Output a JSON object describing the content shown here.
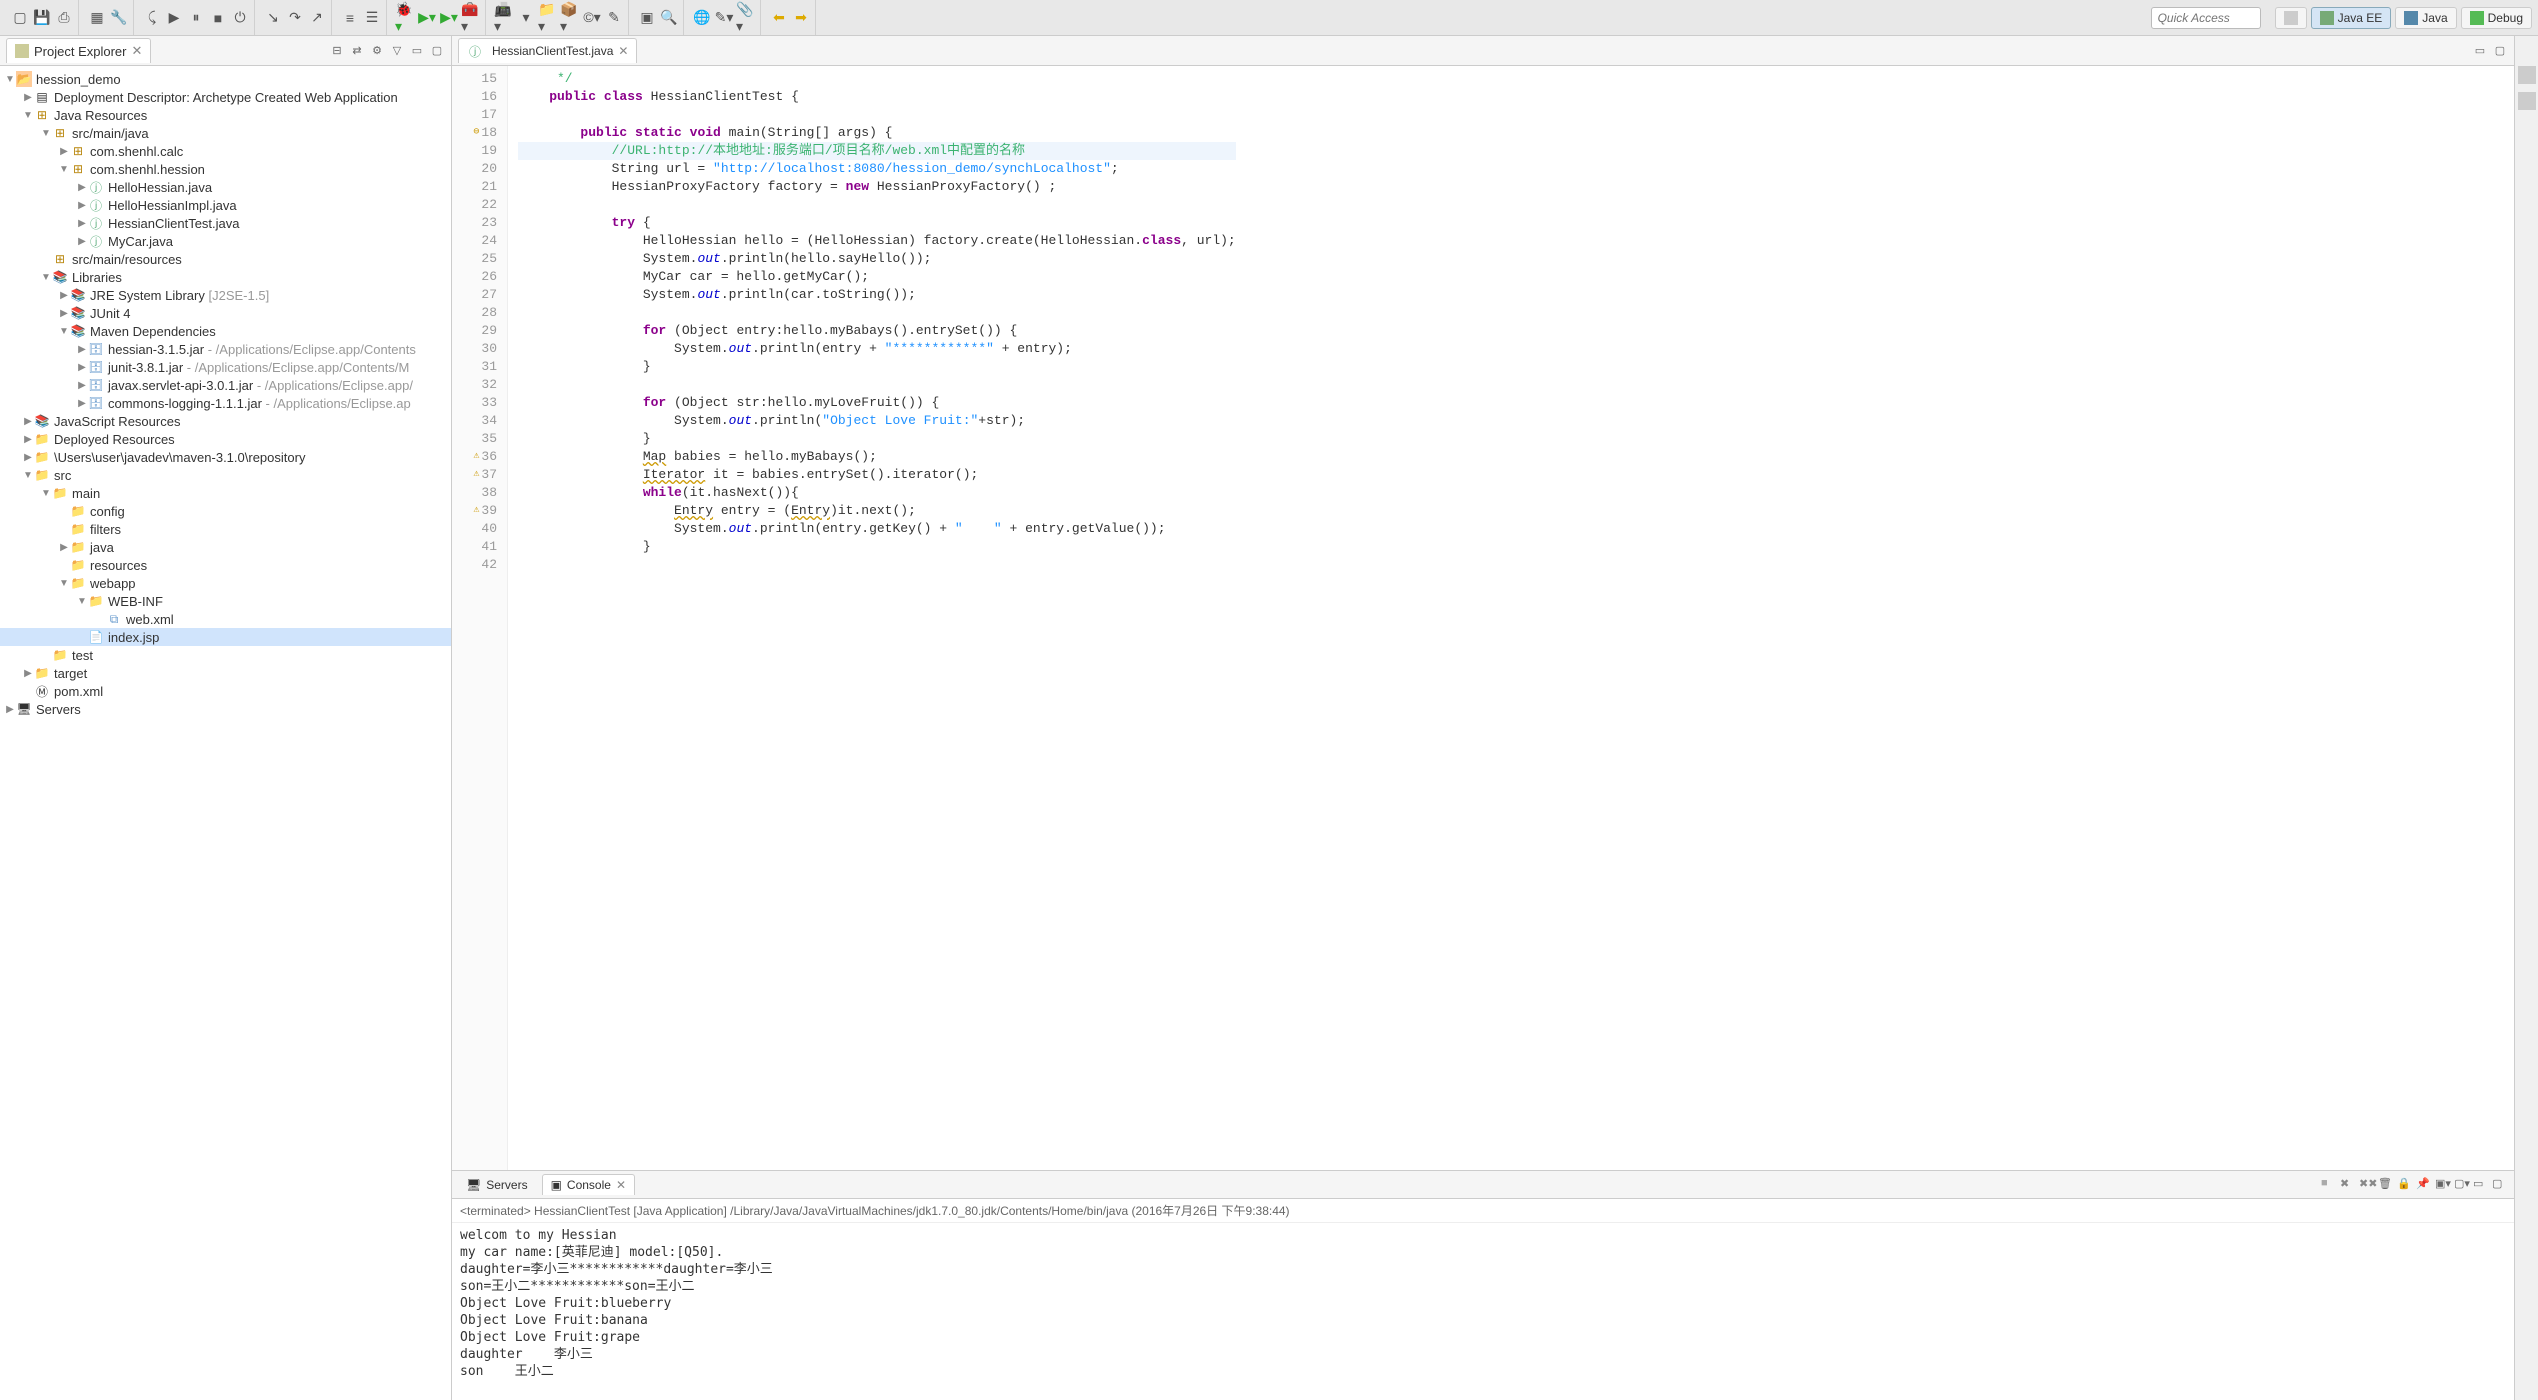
{
  "quick_access_placeholder": "Quick Access",
  "perspectives": [
    {
      "key": "open",
      "label": "",
      "icon": "window"
    },
    {
      "key": "javaee",
      "label": "Java EE",
      "active": true
    },
    {
      "key": "java",
      "label": "Java"
    },
    {
      "key": "debug",
      "label": "Debug"
    }
  ],
  "project_explorer": {
    "title": "Project Explorer",
    "tree": {
      "project": "hession_demo",
      "dd": "Deployment Descriptor: Archetype Created Web Application",
      "java_resources": "Java Resources",
      "src_main_java": "src/main/java",
      "pkg_calc": "com.shenhl.calc",
      "pkg_hession": "com.shenhl.hession",
      "files": {
        "hello_hessian": "HelloHessian.java",
        "hello_hessian_impl": "HelloHessianImpl.java",
        "hessian_client_test": "HessianClientTest.java",
        "mycar": "MyCar.java"
      },
      "src_main_resources": "src/main/resources",
      "libraries": "Libraries",
      "jre": "JRE System Library",
      "jre_qualifier": "[J2SE-1.5]",
      "junit": "JUnit 4",
      "maven_deps": "Maven Dependencies",
      "jars": {
        "hessian": "hessian-3.1.5.jar",
        "hessian_q": " - /Applications/Eclipse.app/Contents",
        "junit_jar": "junit-3.8.1.jar",
        "junit_q": " - /Applications/Eclipse.app/Contents/M",
        "servlet": "javax.servlet-api-3.0.1.jar",
        "servlet_q": " - /Applications/Eclipse.app/",
        "logging": "commons-logging-1.1.1.jar",
        "logging_q": " - /Applications/Eclipse.ap"
      },
      "js_resources": "JavaScript Resources",
      "deployed": "Deployed Resources",
      "repo_path": "\\Users\\user\\javadev\\maven-3.1.0\\repository",
      "src_folder": "src",
      "main": "main",
      "config": "config",
      "filters": "filters",
      "java_folder": "java",
      "resources": "resources",
      "webapp": "webapp",
      "web_inf": "WEB-INF",
      "web_xml": "web.xml",
      "index_jsp": "index.jsp",
      "test": "test",
      "target": "target",
      "pom": "pom.xml",
      "servers": "Servers"
    }
  },
  "editor": {
    "tab_name": "HessianClientTest.java",
    "lines": [
      {
        "n": 15,
        "t": "     */",
        "cls": "cmt"
      },
      {
        "n": 16,
        "tokens": [
          {
            "t": "    ",
            "c": ""
          },
          {
            "t": "public class",
            "c": "kw"
          },
          {
            "t": " HessianClientTest {",
            "c": ""
          }
        ]
      },
      {
        "n": 17,
        "t": ""
      },
      {
        "n": 18,
        "marker": "⊖",
        "tokens": [
          {
            "t": "        ",
            "c": ""
          },
          {
            "t": "public static void",
            "c": "kw"
          },
          {
            "t": " main(String[] args) {",
            "c": ""
          }
        ]
      },
      {
        "n": 19,
        "hl": true,
        "tokens": [
          {
            "t": "            ",
            "c": ""
          },
          {
            "t": "//URL:http://本地地址:服务端口/项目名称/web.xml中配置的名称",
            "c": "cmt"
          }
        ]
      },
      {
        "n": 20,
        "tokens": [
          {
            "t": "            String url = ",
            "c": ""
          },
          {
            "t": "\"http://localhost:8080/hession_demo/synchLocalhost\"",
            "c": "str"
          },
          {
            "t": ";",
            "c": ""
          }
        ]
      },
      {
        "n": 21,
        "tokens": [
          {
            "t": "            HessianProxyFactory factory = ",
            "c": ""
          },
          {
            "t": "new",
            "c": "kw"
          },
          {
            "t": " HessianProxyFactory() ;",
            "c": ""
          }
        ]
      },
      {
        "n": 22,
        "t": ""
      },
      {
        "n": 23,
        "tokens": [
          {
            "t": "            ",
            "c": ""
          },
          {
            "t": "try",
            "c": "kw"
          },
          {
            "t": " {",
            "c": ""
          }
        ]
      },
      {
        "n": 24,
        "tokens": [
          {
            "t": "                HelloHessian hello = (HelloHessian) factory.create(HelloHessian.",
            "c": ""
          },
          {
            "t": "class",
            "c": "kw"
          },
          {
            "t": ", url);",
            "c": ""
          }
        ]
      },
      {
        "n": 25,
        "tokens": [
          {
            "t": "                System.",
            "c": ""
          },
          {
            "t": "out",
            "c": "field"
          },
          {
            "t": ".println(hello.sayHello());",
            "c": ""
          }
        ]
      },
      {
        "n": 26,
        "t": "                MyCar car = hello.getMyCar();"
      },
      {
        "n": 27,
        "tokens": [
          {
            "t": "                System.",
            "c": ""
          },
          {
            "t": "out",
            "c": "field"
          },
          {
            "t": ".println(car.toString());",
            "c": ""
          }
        ]
      },
      {
        "n": 28,
        "t": ""
      },
      {
        "n": 29,
        "tokens": [
          {
            "t": "                ",
            "c": ""
          },
          {
            "t": "for",
            "c": "kw"
          },
          {
            "t": " (Object entry:hello.myBabays().entrySet()) {",
            "c": ""
          }
        ]
      },
      {
        "n": 30,
        "tokens": [
          {
            "t": "                    System.",
            "c": ""
          },
          {
            "t": "out",
            "c": "field"
          },
          {
            "t": ".println(entry + ",
            "c": ""
          },
          {
            "t": "\"************\"",
            "c": "str"
          },
          {
            "t": " + entry);",
            "c": ""
          }
        ]
      },
      {
        "n": 31,
        "t": "                }"
      },
      {
        "n": 32,
        "t": ""
      },
      {
        "n": 33,
        "tokens": [
          {
            "t": "                ",
            "c": ""
          },
          {
            "t": "for",
            "c": "kw"
          },
          {
            "t": " (Object str:hello.myLoveFruit()) {",
            "c": ""
          }
        ]
      },
      {
        "n": 34,
        "tokens": [
          {
            "t": "                    System.",
            "c": ""
          },
          {
            "t": "out",
            "c": "field"
          },
          {
            "t": ".println(",
            "c": ""
          },
          {
            "t": "\"Object Love Fruit:\"",
            "c": "str"
          },
          {
            "t": "+str);",
            "c": ""
          }
        ]
      },
      {
        "n": 35,
        "t": "                }"
      },
      {
        "n": 36,
        "warn": true,
        "tokens": [
          {
            "t": "                ",
            "c": ""
          },
          {
            "t": "Map",
            "c": "warn"
          },
          {
            "t": " babies = hello.myBabays();",
            "c": ""
          }
        ]
      },
      {
        "n": 37,
        "warn": true,
        "tokens": [
          {
            "t": "                ",
            "c": ""
          },
          {
            "t": "Iterator",
            "c": "warn"
          },
          {
            "t": " it = babies.entrySet().iterator();",
            "c": ""
          }
        ]
      },
      {
        "n": 38,
        "tokens": [
          {
            "t": "                ",
            "c": ""
          },
          {
            "t": "while",
            "c": "kw"
          },
          {
            "t": "(it.hasNext()){",
            "c": ""
          }
        ]
      },
      {
        "n": 39,
        "warn": true,
        "tokens": [
          {
            "t": "                    ",
            "c": ""
          },
          {
            "t": "Entry",
            "c": "warn"
          },
          {
            "t": " entry = (",
            "c": ""
          },
          {
            "t": "Entry",
            "c": "warn"
          },
          {
            "t": ")it.next();",
            "c": ""
          }
        ]
      },
      {
        "n": 40,
        "tokens": [
          {
            "t": "                    System.",
            "c": ""
          },
          {
            "t": "out",
            "c": "field"
          },
          {
            "t": ".println(entry.getKey() + ",
            "c": ""
          },
          {
            "t": "\"    \"",
            "c": "str"
          },
          {
            "t": " + entry.getValue());",
            "c": ""
          }
        ]
      },
      {
        "n": 41,
        "t": "                }"
      },
      {
        "n": 42,
        "t": ""
      }
    ]
  },
  "console": {
    "tabs": {
      "servers": "Servers",
      "console": "Console"
    },
    "status": "<terminated> HessianClientTest [Java Application] /Library/Java/JavaVirtualMachines/jdk1.7.0_80.jdk/Contents/Home/bin/java (2016年7月26日 下午9:38:44)",
    "output": "welcom to my Hessian\nmy car name:[英菲尼迪] model:[Q50].\ndaughter=李小三************daughter=李小三\nson=王小二************son=王小二\nObject Love Fruit:blueberry\nObject Love Fruit:banana\nObject Love Fruit:grape\ndaughter    李小三\nson    王小二"
  }
}
